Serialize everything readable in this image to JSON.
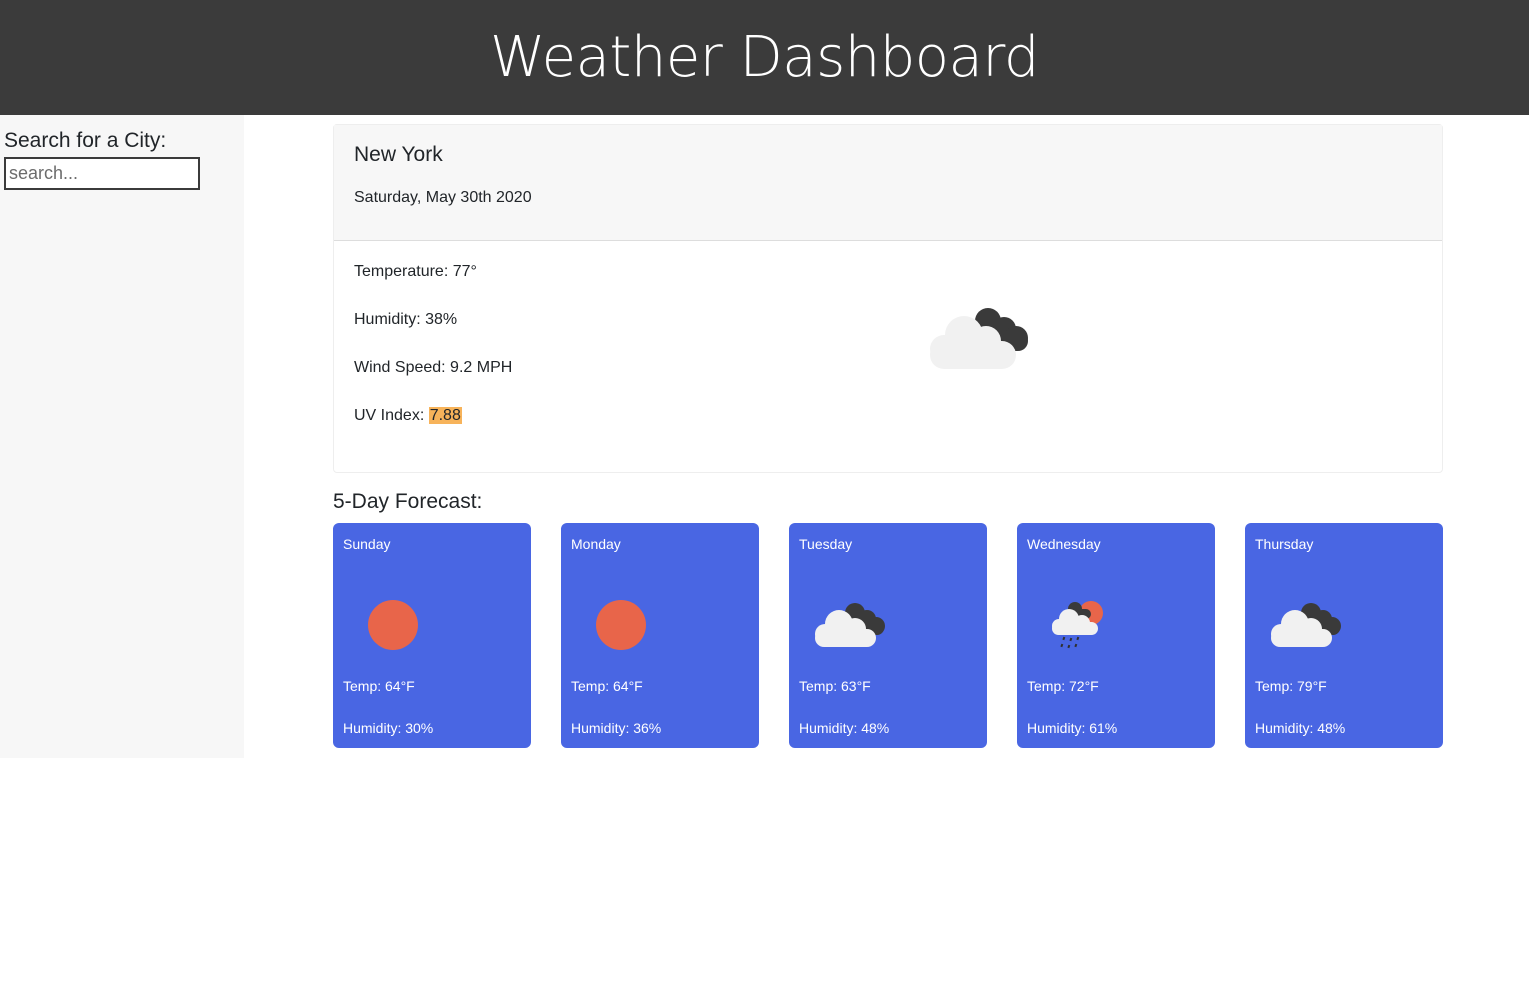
{
  "header": {
    "title": "Weather Dashboard"
  },
  "sidebar": {
    "search_label": "Search for a City:",
    "search_placeholder": "search..."
  },
  "current": {
    "city": "New York",
    "date": "Saturday, May 30th 2020",
    "temperature": "Temperature: 77°",
    "humidity": "Humidity: 38%",
    "wind": "Wind Speed: 9.2 MPH",
    "uv_label": "UV Index: ",
    "uv_value": "7.88",
    "uv_color": "#f7b35a",
    "icon": "partly-cloudy-icon"
  },
  "forecast": {
    "title": "5-Day Forecast:",
    "card_color": "#4966e3",
    "days": [
      {
        "day": "Sunday",
        "temp": "Temp: 64°F",
        "humidity": "Humidity: 30%",
        "icon": "sun-icon"
      },
      {
        "day": "Monday",
        "temp": "Temp: 64°F",
        "humidity": "Humidity: 36%",
        "icon": "sun-icon"
      },
      {
        "day": "Tuesday",
        "temp": "Temp: 63°F",
        "humidity": "Humidity: 48%",
        "icon": "cloudy-icon"
      },
      {
        "day": "Wednesday",
        "temp": "Temp: 72°F",
        "humidity": "Humidity: 61%",
        "icon": "rain-icon"
      },
      {
        "day": "Thursday",
        "temp": "Temp: 79°F",
        "humidity": "Humidity: 48%",
        "icon": "cloudy-icon"
      }
    ]
  }
}
